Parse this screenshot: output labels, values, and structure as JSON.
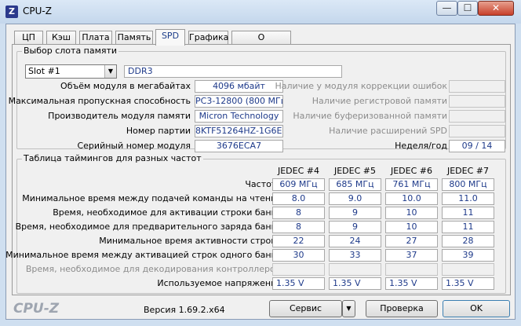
{
  "window": {
    "title": "CPU-Z",
    "icon_letter": "Z",
    "minimize_glyph": "—",
    "maximize_glyph": "☐",
    "close_glyph": "✕"
  },
  "tabs": [
    {
      "label": "ЦП"
    },
    {
      "label": "Кэш"
    },
    {
      "label": "Плата"
    },
    {
      "label": "Память"
    },
    {
      "label": "SPD",
      "active": true
    },
    {
      "label": "Графика"
    },
    {
      "label": "О программе"
    }
  ],
  "slot": {
    "title": "Выбор слота памяти",
    "selected": "Slot #1",
    "type": "DDR3",
    "labels": {
      "size": "Объём модуля в мегабайтах",
      "bandwidth": "Максимальная пропускная способность",
      "manufacturer": "Производитель модуля памяти",
      "part": "Номер партии",
      "serial": "Серийный номер модуля",
      "ecc": "Наличие у модуля коррекции ошибок",
      "registered": "Наличие регистровой памяти",
      "buffered": "Наличие буферизованной памяти",
      "spd_ext": "Наличие расширений SPD",
      "week_year": "Неделя/год"
    },
    "values": {
      "size": "4096 мбайт",
      "bandwidth": "PC3-12800 (800 МГц)",
      "manufacturer": "Micron Technology",
      "part": "8KTF51264HZ-1G6E1",
      "serial": "3676ECA7",
      "week_year": "09 / 14"
    }
  },
  "timings": {
    "title": "Таблица таймингов для разных частот",
    "columns": [
      "JEDEC #4",
      "JEDEC #5",
      "JEDEC #6",
      "JEDEC #7"
    ],
    "rows": [
      {
        "label": "Частота",
        "values": [
          "609 МГц",
          "685 МГц",
          "761 МГц",
          "800 МГц"
        ]
      },
      {
        "label": "Минимальное время между подачей команды на чтение",
        "values": [
          "8.0",
          "9.0",
          "10.0",
          "11.0"
        ]
      },
      {
        "label": "Время, необходимое для активации строки банка",
        "values": [
          "8",
          "9",
          "10",
          "11"
        ]
      },
      {
        "label": "Время, необходимое для предварительного заряда банка",
        "values": [
          "8",
          "9",
          "10",
          "11"
        ]
      },
      {
        "label": "Минимальное время активности строки",
        "values": [
          "22",
          "24",
          "27",
          "28"
        ]
      },
      {
        "label": "Минимальное время между активацией строк одного банка",
        "values": [
          "30",
          "33",
          "37",
          "39"
        ]
      },
      {
        "label": "Время, необходимое для декодирования контроллером",
        "values": [
          "",
          "",
          "",
          ""
        ],
        "disabled": true
      },
      {
        "label": "Используемое напряжение",
        "values": [
          "1.35 V",
          "1.35 V",
          "1.35 V",
          "1.35 V"
        ]
      }
    ]
  },
  "footer": {
    "logo": "CPU-Z",
    "version": "Версия 1.69.2.x64",
    "tools_label": "Сервис",
    "validate_label": "Проверка",
    "ok_label": "OK"
  }
}
